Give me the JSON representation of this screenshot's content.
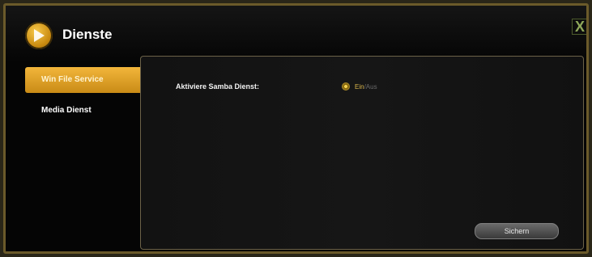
{
  "window": {
    "title": "Dienste",
    "close_label": "X"
  },
  "sidebar": {
    "items": [
      {
        "label": "Win File Service",
        "active": true
      },
      {
        "label": "Media Dienst",
        "active": false
      }
    ]
  },
  "panel": {
    "field_label": "Aktiviere Samba Dienst:",
    "toggle_on": "Ein",
    "toggle_separator": "/",
    "toggle_off": "Aus",
    "save_label": "Sichern"
  },
  "colors": {
    "accent": "#e2a52a",
    "border": "#6b5a2a",
    "background": "#050505"
  },
  "icons": {
    "app": "play-circle-icon",
    "radio": "radio-selected-icon"
  }
}
